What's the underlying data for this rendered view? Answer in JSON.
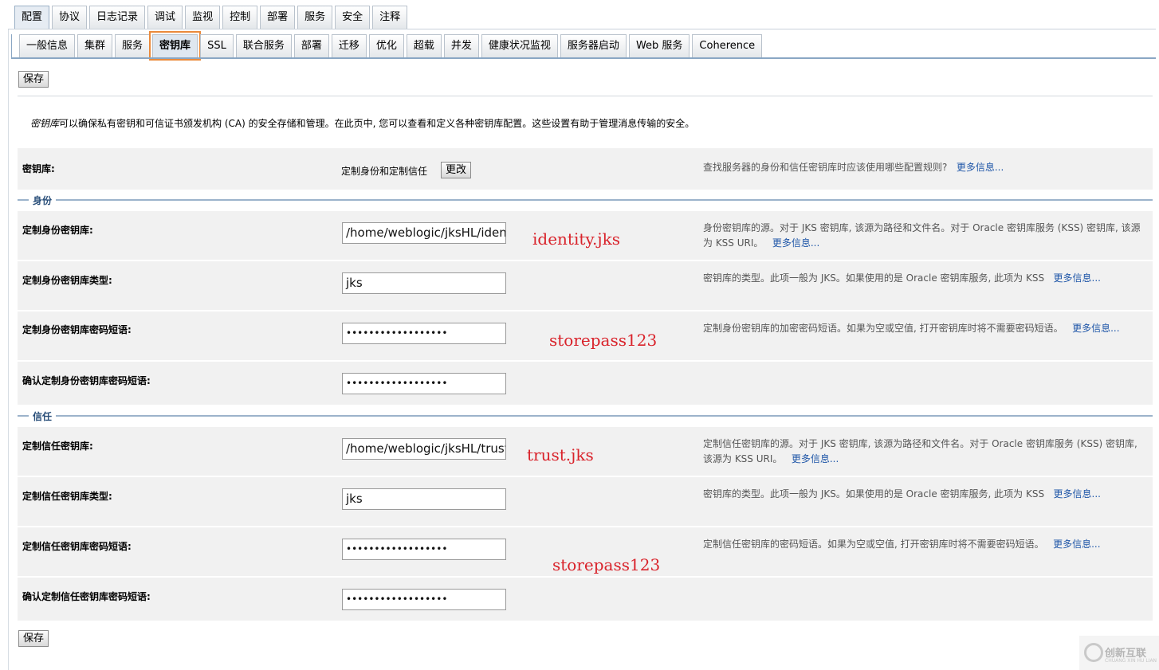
{
  "tabs_top": [
    "配置",
    "协议",
    "日志记录",
    "调试",
    "监视",
    "控制",
    "部署",
    "服务",
    "安全",
    "注释"
  ],
  "tabs_second": [
    "一般信息",
    "集群",
    "服务",
    "密钥库",
    "SSL",
    "联合服务",
    "部署",
    "迁移",
    "优化",
    "超载",
    "并发",
    "健康状况监视",
    "服务器启动",
    "Web 服务",
    "Coherence"
  ],
  "save_label": "保存",
  "intro": {
    "term": "密钥库",
    "text": "可以确保私有密钥和可信证书颁发机构 (CA) 的安全存储和管理。在此页中, 您可以查看和定义各种密钥库配置。这些设置有助于管理消息传输的安全。"
  },
  "keystore": {
    "label": "密钥库:",
    "value": "定制身份和定制信任",
    "change_label": "更改",
    "help": "查找服务器的身份和信任密钥库时应该使用哪些配置规则?",
    "more": "更多信息..."
  },
  "identity": {
    "title": "身份",
    "keystore_label": "定制身份密钥库:",
    "keystore_value": "/home/weblogic/jksHL/identity.jks",
    "keystore_help": "身份密钥库的源。对于 JKS 密钥库, 该源为路径和文件名。对于 Oracle 密钥库服务 (KSS) 密钥库, 该源为 KSS URI。",
    "type_label": "定制身份密钥库类型:",
    "type_value": "jks",
    "type_help": "密钥库的类型。此项一般为 JKS。如果使用的是 Oracle 密钥库服务, 此项为 KSS",
    "pass_label": "定制身份密钥库密码短语:",
    "pass_value": "••••••••••••••••••",
    "pass_help": "定制身份密钥库的加密密码短语。如果为空或空值, 打开密钥库时将不需要密码短语。",
    "confirm_label": "确认定制身份密钥库密码短语:",
    "confirm_value": "••••••••••••••••••"
  },
  "trust": {
    "title": "信任",
    "keystore_label": "定制信任密钥库:",
    "keystore_value": "/home/weblogic/jksHL/trust.jks",
    "keystore_help": "定制信任密钥库的源。对于 JKS 密钥库, 该源为路径和文件名。对于 Oracle 密钥库服务 (KSS) 密钥库, 该源为 KSS URI。",
    "type_label": "定制信任密钥库类型:",
    "type_value": "jks",
    "type_help": "密钥库的类型。此项一般为 JKS。如果使用的是 Oracle 密钥库服务, 此项为 KSS",
    "pass_label": "定制信任密钥库密码短语:",
    "pass_value": "••••••••••••••••••",
    "pass_help": "定制信任密钥库的密码短语。如果为空或空值, 打开密钥库时将不需要密码短语。",
    "confirm_label": "确认定制信任密钥库密码短语:",
    "confirm_value": "••••••••••••••••••"
  },
  "more_info": "更多信息...",
  "annotations": {
    "identity_file": "identity.jks",
    "identity_pass": "storepass123",
    "trust_file": "trust.jks",
    "trust_pass": "storepass123"
  },
  "watermark": {
    "text": "创新互联",
    "sub": "CHUANG XIN HU LIAN"
  },
  "colors": {
    "active_tab_outline": "#ea8a3c",
    "link": "#1f56a8",
    "annotation": "#d9232b",
    "section_title": "#2a4f7a"
  }
}
